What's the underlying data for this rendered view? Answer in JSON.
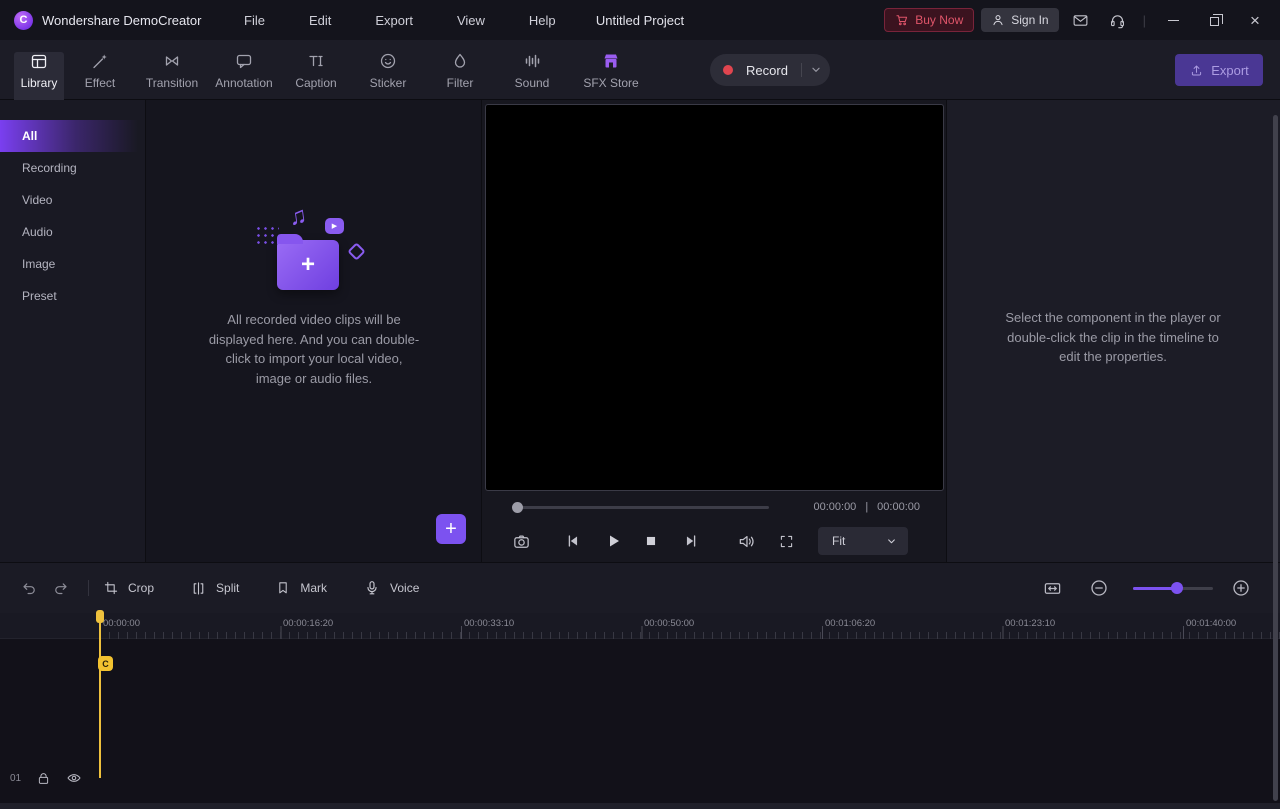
{
  "titlebar": {
    "app_name": "Wondershare DemoCreator",
    "logo_letter": "C",
    "menus": [
      {
        "label": "File"
      },
      {
        "label": "Edit"
      },
      {
        "label": "Export"
      },
      {
        "label": "View"
      },
      {
        "label": "Help"
      }
    ],
    "project_title": "Untitled Project",
    "buy_now_label": "Buy Now",
    "sign_in_label": "Sign In",
    "separator": "|"
  },
  "toolbar": {
    "tabs": [
      {
        "label": "Library",
        "selected": true
      },
      {
        "label": "Effect"
      },
      {
        "label": "Transition"
      },
      {
        "label": "Annotation"
      },
      {
        "label": "Caption"
      },
      {
        "label": "Sticker"
      },
      {
        "label": "Filter"
      },
      {
        "label": "Sound"
      },
      {
        "label": "SFX Store"
      }
    ],
    "record_label": "Record",
    "export_label": "Export"
  },
  "library": {
    "categories": [
      {
        "label": "All",
        "selected": true
      },
      {
        "label": "Recording"
      },
      {
        "label": "Video"
      },
      {
        "label": "Audio"
      },
      {
        "label": "Image"
      },
      {
        "label": "Preset"
      }
    ],
    "empty_state": {
      "line1": "All recorded video clips will be",
      "line2": "displayed here. And you can double-",
      "line3": "click to import your local video,",
      "line4": "image or audio files."
    },
    "add_button": "+",
    "music_note": "♫",
    "video_chip_glyph": "▶"
  },
  "player": {
    "current_time": "00:00:00",
    "total_time": "00:00:00",
    "time_separator": "|",
    "fit_label": "Fit"
  },
  "properties": {
    "line1": "Select the component in the player or",
    "line2": "double-click the clip in the timeline to",
    "line3": "edit the properties."
  },
  "timeline": {
    "tools": [
      {
        "label": "Crop"
      },
      {
        "label": "Split"
      },
      {
        "label": "Mark"
      },
      {
        "label": "Voice"
      }
    ],
    "ruler_labels": [
      "00:00:00",
      "00:00:16:20",
      "00:00:33:10",
      "00:00:50:00",
      "00:01:06:20",
      "00:01:23:10",
      "00:01:40:00"
    ],
    "track_number": "01",
    "marker_badge": "C"
  },
  "colors": {
    "accent_purple": "#7c52f0",
    "record_red": "#e0454f",
    "playhead_yellow": "#eec13d",
    "buy_now_red": "#e0556a"
  },
  "icons": {
    "close-icon": "×",
    "minimize-icon": "–",
    "maximize-icon": "❐",
    "mail-icon": "envelope",
    "headset-icon": "headset",
    "cart-icon": "cart",
    "person-icon": "person",
    "chevron-down-icon": "⌄",
    "snapshot-icon": "camera",
    "play-icon": "▶",
    "stop-icon": "■",
    "volume-icon": "speaker",
    "fullscreen-icon": "expand",
    "undo-icon": "↺",
    "redo-icon": "↻",
    "lock-icon": "padlock",
    "eye-icon": "visibility"
  }
}
